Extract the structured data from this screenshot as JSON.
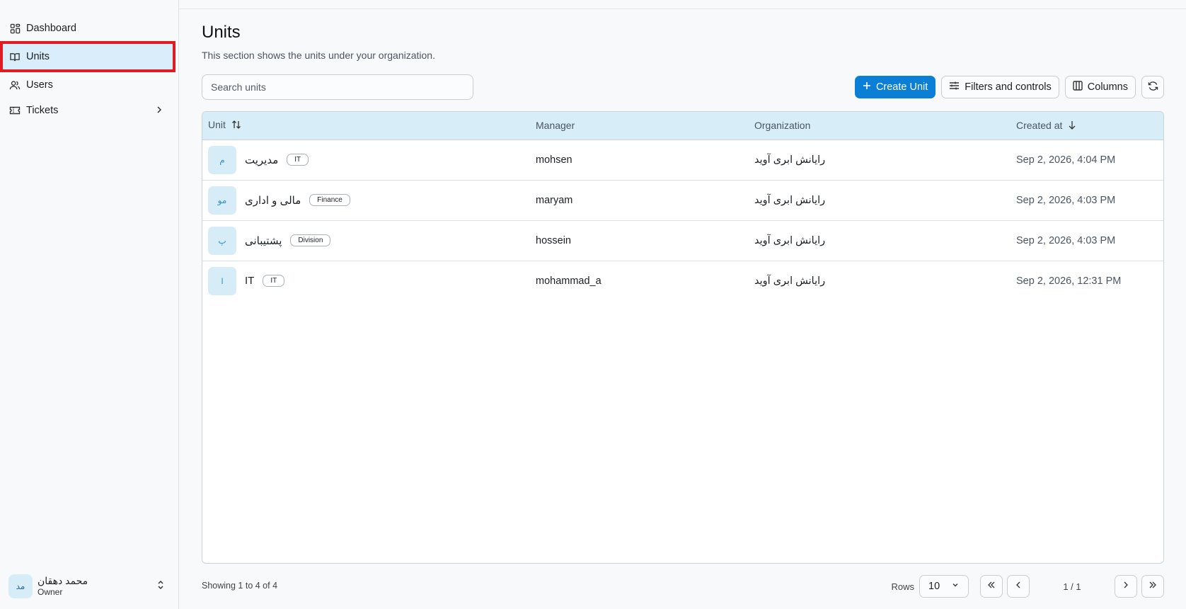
{
  "sidebar": {
    "items": [
      {
        "label": "Dashboard",
        "icon": "dashboard-grid-icon"
      },
      {
        "label": "Units",
        "icon": "book-icon",
        "active": true
      },
      {
        "label": "Users",
        "icon": "users-icon"
      },
      {
        "label": "Tickets",
        "icon": "ticket-icon",
        "has_children": true
      }
    ],
    "user": {
      "initials": "مد",
      "name": "محمد دهقان",
      "role": "Owner"
    }
  },
  "page": {
    "title": "Units",
    "subtitle": "This section shows the units under your organization."
  },
  "search": {
    "placeholder": "Search units"
  },
  "toolbar": {
    "create_label": "Create Unit",
    "filters_label": "Filters and controls",
    "columns_label": "Columns"
  },
  "table": {
    "columns": [
      "Unit",
      "Manager",
      "Organization",
      "Created at"
    ],
    "rows": [
      {
        "initial": "م",
        "name": "مدیریت",
        "tag": "IT",
        "manager": "mohsen",
        "organization": "رایانش ابری آوید",
        "created": "Sep 2, 2026, 4:04 PM"
      },
      {
        "initial": "مو",
        "name": "مالی و اداری",
        "tag": "Finance",
        "manager": "maryam",
        "organization": "رایانش ابری آوید",
        "created": "Sep 2, 2026, 4:03 PM"
      },
      {
        "initial": "پ",
        "name": "پشتیبانی",
        "tag": "Division",
        "manager": "hossein",
        "organization": "رایانش ابری آوید",
        "created": "Sep 2, 2026, 4:03 PM"
      },
      {
        "initial": "I",
        "name": "IT",
        "tag": "IT",
        "manager": "mohammad_a",
        "organization": "رایانش ابری آوید",
        "created": "Sep 2, 2026, 12:31 PM"
      }
    ]
  },
  "footer": {
    "showing": "Showing 1 to 4 of 4",
    "rows_label": "Rows",
    "rows_value": "10",
    "page_info": "1 / 1"
  },
  "colors": {
    "accent": "#0b7ed6",
    "active_bg": "#d9eefa",
    "highlight_border": "#e01b24",
    "header_bg": "#d7eef8"
  }
}
